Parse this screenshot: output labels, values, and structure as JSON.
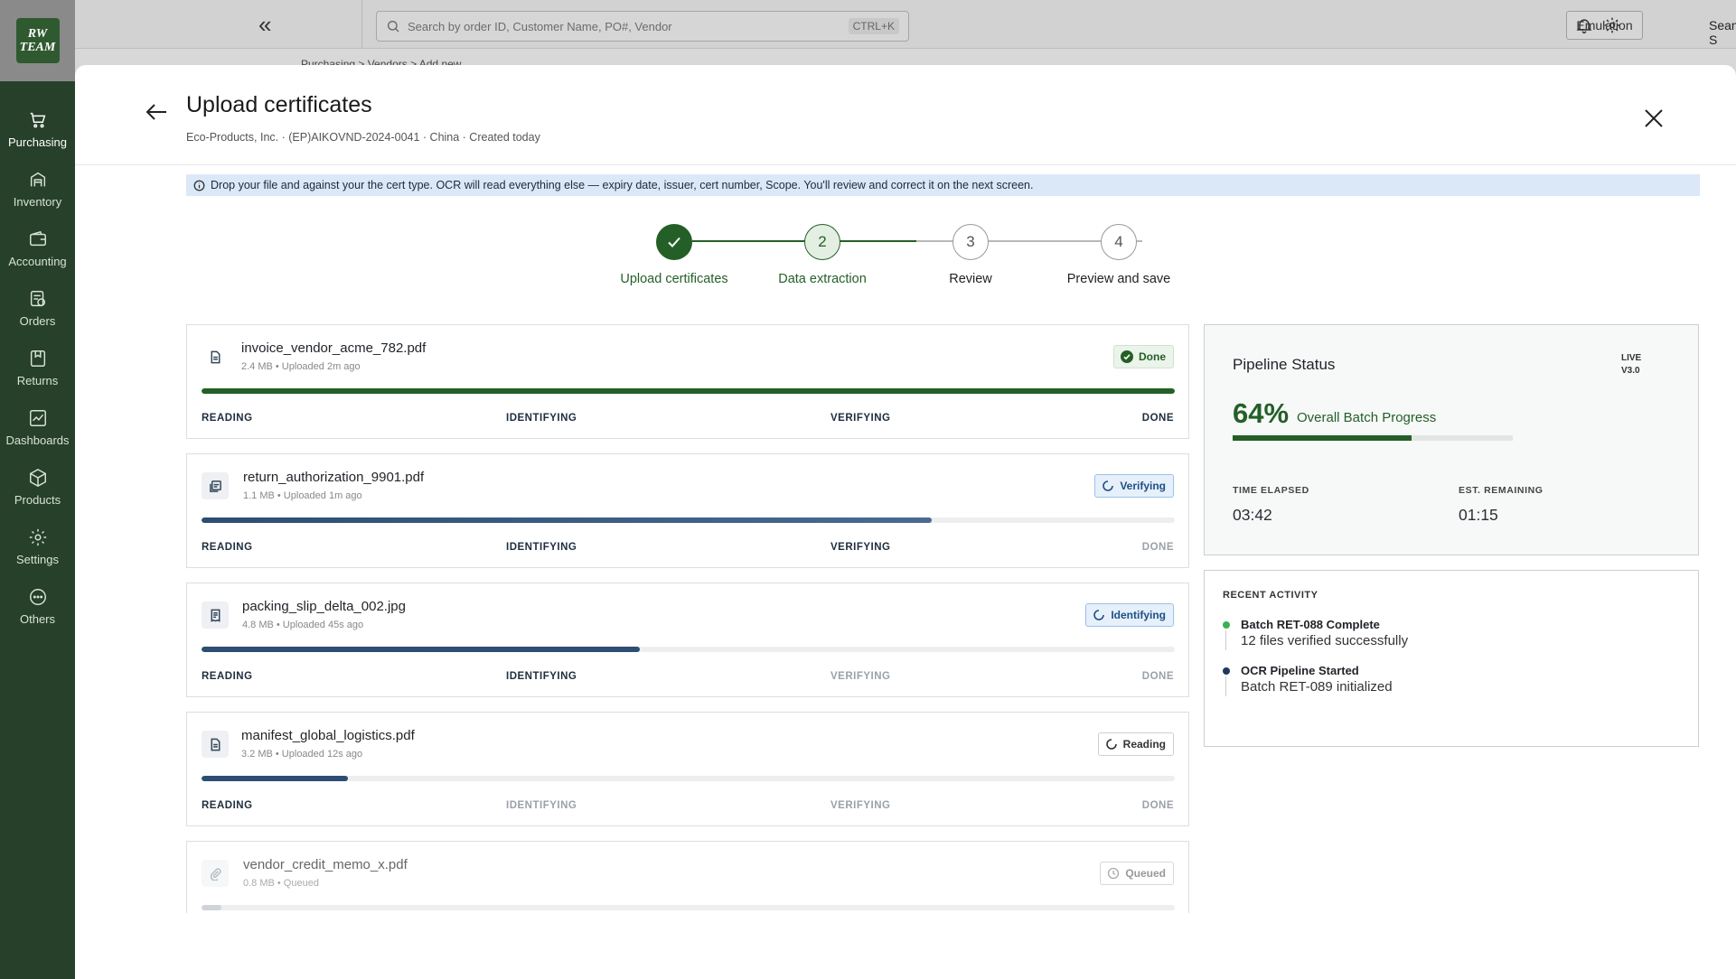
{
  "sidebar": {
    "logo_text": "RW TEAM",
    "items": [
      {
        "label": "Purchasing",
        "icon": "cart-icon",
        "active": true
      },
      {
        "label": "Inventory",
        "icon": "warehouse-icon"
      },
      {
        "label": "Accounting",
        "icon": "wallet-icon"
      },
      {
        "label": "Orders",
        "icon": "orders-icon"
      },
      {
        "label": "Returns",
        "icon": "returns-icon"
      },
      {
        "label": "Dashboards",
        "icon": "dashboard-icon"
      },
      {
        "label": "Products",
        "icon": "box-icon"
      },
      {
        "label": "Settings",
        "icon": "gear-icon"
      },
      {
        "label": "Others",
        "icon": "more-icon"
      }
    ]
  },
  "topbar": {
    "search_placeholder": "Search by order ID, Customer Name, PO#, Vendor",
    "shortcut": "CTRL+K",
    "emulation_label": "Emulation",
    "user_name": "Sean S",
    "user_initials": "SS",
    "breadcrumb": "Purchasing > Vendors > Add new"
  },
  "modal": {
    "title": "Upload certificates",
    "subtitle": "Eco-Products, Inc.  · (EP)AIKOVND-2024-0041 · China · Created today",
    "info": "Drop your file and against your the cert type. OCR will read everything else — expiry date, issuer, cert number, Scope. You'll review and correct it on the next screen."
  },
  "steps": [
    {
      "number": "1",
      "label": "Upload certificates",
      "state": "complete"
    },
    {
      "number": "2",
      "label": "Data extraction",
      "state": "current"
    },
    {
      "number": "3",
      "label": "Review",
      "state": "upcoming"
    },
    {
      "number": "4",
      "label": "Preview and save",
      "state": "upcoming"
    }
  ],
  "stage_labels": [
    "READING",
    "IDENTIFYING",
    "VERIFYING",
    "DONE"
  ],
  "files": [
    {
      "name": "invoice_vendor_acme_782.pdf",
      "meta": "2.4 MB • Uploaded 2m ago",
      "status": "Done",
      "progress": 1.0,
      "stage_index": 3
    },
    {
      "name": "return_authorization_9901.pdf",
      "meta": "1.1 MB • Uploaded 1m ago",
      "status": "Verifying",
      "progress": 0.75,
      "stage_index": 2
    },
    {
      "name": "packing_slip_delta_002.jpg",
      "meta": "4.8 MB • Uploaded 45s ago",
      "status": "Identifying",
      "progress": 0.45,
      "stage_index": 1
    },
    {
      "name": "manifest_global_logistics.pdf",
      "meta": "3.2 MB • Uploaded 12s ago",
      "status": "Reading",
      "progress": 0.15,
      "stage_index": 0
    },
    {
      "name": "vendor_credit_memo_x.pdf",
      "meta": "0.8 MB • Queued",
      "status": "Queued",
      "progress": 0.02,
      "stage_index": -1
    }
  ],
  "pipeline": {
    "title": "Pipeline Status",
    "live_line1": "LIVE",
    "live_line2": "V3.0",
    "percent_text": "64%",
    "percent_value": 64,
    "percent_label": "Overall Batch Progress",
    "time_elapsed_label": "TIME ELAPSED",
    "time_elapsed": "03:42",
    "remaining_label": "EST. REMAINING",
    "remaining": "01:15"
  },
  "activity": {
    "title": "RECENT ACTIVITY",
    "items": [
      {
        "title": "Batch RET-088 Complete",
        "detail": "12 files verified successfully",
        "color": "#3bb055"
      },
      {
        "title": "OCR Pipeline Started",
        "detail": "Batch RET-089 initialized",
        "color": "#1d3a5c"
      }
    ]
  },
  "colors": {
    "brand_green": "#245f27",
    "sidebar_bg": "#26402a",
    "progress_blue": "#2d4d73",
    "info_bg": "#dbe8f8"
  }
}
